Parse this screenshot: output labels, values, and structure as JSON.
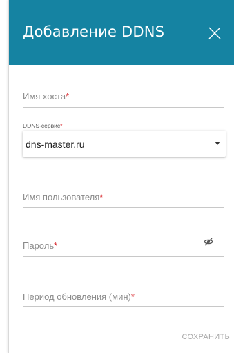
{
  "dialog": {
    "title": "Добавление DDNS",
    "close_icon": "close-icon",
    "header_color": "#1583a2"
  },
  "fields": {
    "hostname": {
      "label": "Имя хоста",
      "required_mark": "*",
      "value": ""
    },
    "service": {
      "label": "DDNS-сервис",
      "required_mark": "*",
      "value": "dns-master.ru",
      "icon": "chevron-down-icon"
    },
    "username": {
      "label": "Имя пользователя",
      "required_mark": "*",
      "value": ""
    },
    "password": {
      "label": "Пароль",
      "required_mark": "*",
      "value": "",
      "icon": "eye-off-icon"
    },
    "period": {
      "label": "Период обновления (мин)",
      "required_mark": "*",
      "value": ""
    }
  },
  "actions": {
    "save_label": "СОХРАНИТЬ"
  },
  "colors": {
    "required": "#d8262c",
    "label": "#8a8a8a",
    "save_disabled": "#a8a8a8"
  }
}
